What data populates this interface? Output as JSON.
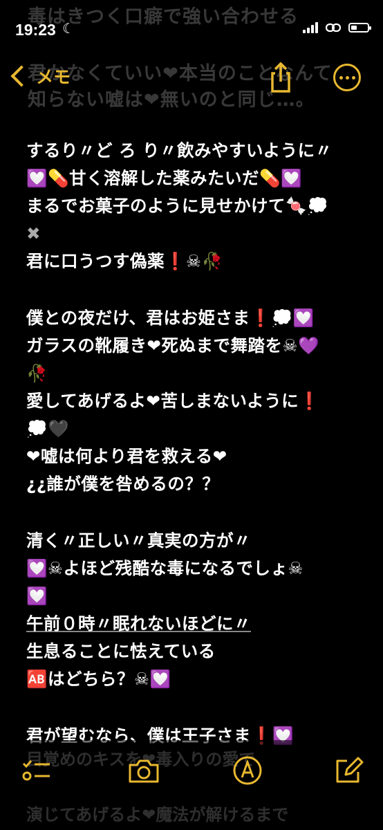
{
  "status_bar": {
    "time": "19:23",
    "moon": "☾",
    "battery_level": 0.35
  },
  "ghost_top": [
    "毒はきつく口癖で強い合わせる",
    "君かなくていい❤本当のことなんて",
    "知らない嘘は❤無いのと同じ…。"
  ],
  "nav": {
    "back_label": "メモ"
  },
  "lines": [
    "するり〃ど ろ り〃飲みやすいように〃",
    "💟💊甘く溶解した薬みたいだ💊💟",
    "まるでお菓子のように見せかけて🍬💭",
    "✖",
    "君に口うつす偽薬❗☠🥀",
    "",
    "僕との夜だけ、君はお姫さま❗💭💟",
    "ガラスの靴履き❤死ぬまで舞踏を☠💜",
    "🥀",
    "愛してあげるよ❤苦しまないように❗",
    "💭🖤",
    "❤嘘は何より君を救える❤",
    "¿¿誰が僕を咎めるの？？",
    "",
    "清く〃正しい〃真実の方が〃",
    "💟☠よほど残酷な毒になるでしょ☠",
    "💟",
    "午前０時〃眠れないほどに〃",
    "生息ることに怯えている",
    "🆎はどちら？☠💟",
    "",
    "君が望むなら、僕は王子さま❗💟"
  ],
  "ghost_bottom": [
    "目覚めのキスを❤毒入りの愛で",
    "演じてあげるよ❤魔法が解けるまで"
  ]
}
